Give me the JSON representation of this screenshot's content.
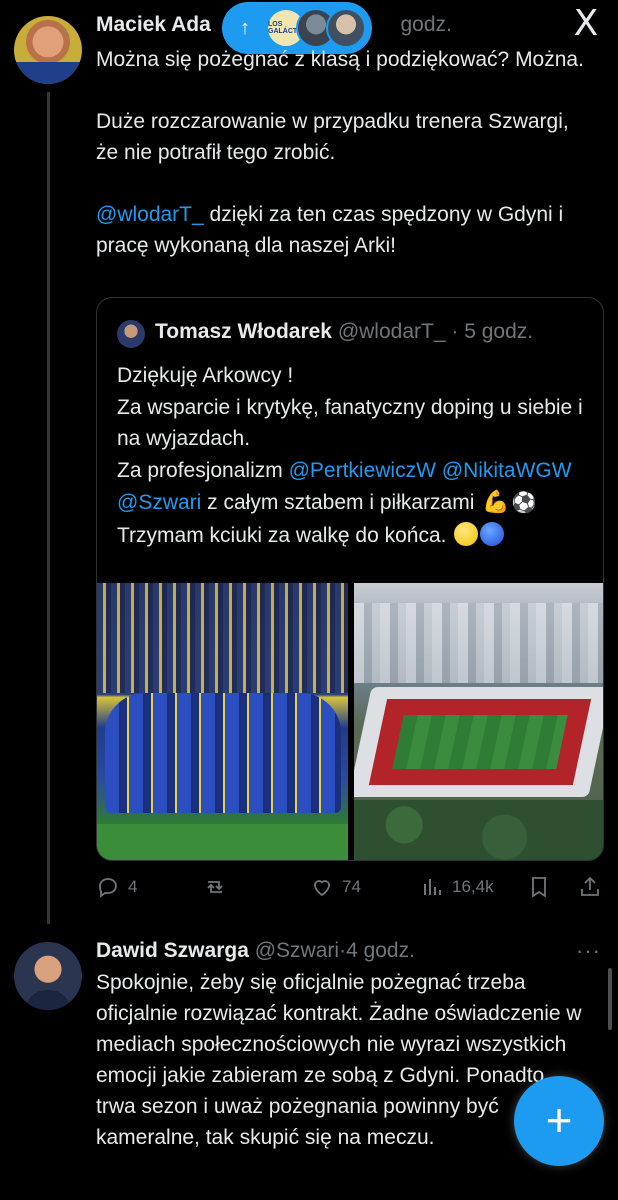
{
  "tweet1": {
    "name": "Maciek Ada",
    "time": "godz.",
    "lines": [
      "Można się pożegnać z klasą i podziękować? Można.",
      "Duże rozczarowanie w przypadku trenera Szwargi, że nie potrafił tego zrobić."
    ],
    "mention": "@wlodarT_",
    "mention_rest": " dzięki za ten czas spędzony w Gdyni i pracę wykonaną dla naszej Arki!",
    "stats": {
      "replies": "4",
      "likes": "74",
      "views": "16,4k"
    }
  },
  "scroll_pill": {
    "arrow": "↑",
    "badge_text": "LOS GALÁCTI"
  },
  "close_icon": "X",
  "quote": {
    "name": "Tomasz Włodarek",
    "handle": "@wlodarT_",
    "dot": "·",
    "time": "5 godz.",
    "line1": "Dziękuję  Arkowcy !",
    "line2": "Za wsparcie i krytykę, fanatyczny doping u siebie i na wyjazdach.",
    "line3_start": "Za profesjonalizm ",
    "mention1": "@PertkiewiczW",
    "mention2": "@NikitaWGW",
    "mention3": "@Szwari",
    "line3_end": " z całym sztabem i piłkarzami ",
    "emoji_muscle": "💪",
    "emoji_ball": "⚽",
    "line4": "Trzymam kciuki za walkę do końca. "
  },
  "tweet2": {
    "name": "Dawid Szwarga",
    "handle": "@Szwari",
    "dot": "·",
    "time": "4 godz.",
    "text": "Spokojnie, żeby się oficjalnie pożegnać trzeba oficjalnie rozwiązać kontrakt. Żadne oświadczenie w mediach społecznościowych nie wyrazi wszystkich emocji jakie zabieram ze sobą z Gdyni. Ponadto trwa sezon i uważ pożegnania powinny być kameralne, tak skupić się na meczu."
  },
  "more_icon": "···",
  "fab_icon": "+"
}
